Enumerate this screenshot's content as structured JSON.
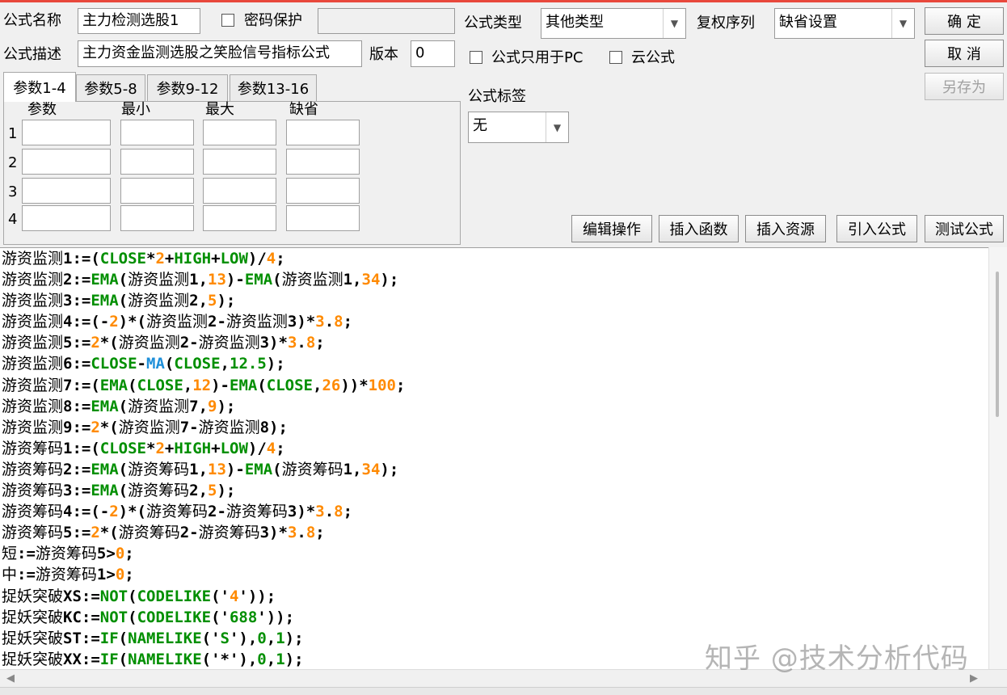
{
  "form": {
    "name_label": "公式名称",
    "name_value": "主力检测选股1",
    "password_label": "密码保护",
    "desc_label": "公式描述",
    "desc_value": "主力资金监测选股之笑脸信号指标公式",
    "version_label": "版本",
    "version_value": "0",
    "type_label": "公式类型",
    "type_value": "其他类型",
    "rights_label": "复权序列",
    "rights_value": "缺省设置",
    "pc_only_label": "公式只用于PC",
    "cloud_label": "云公式",
    "tag_label": "公式标签",
    "tag_value": "无"
  },
  "buttons": {
    "ok": "确  定",
    "cancel": "取  消",
    "save_as": "另存为",
    "edit_ops": "编辑操作",
    "insert_func": "插入函数",
    "insert_res": "插入资源",
    "import_formula": "引入公式",
    "test_formula": "测试公式"
  },
  "param_tabs": [
    "参数1-4",
    "参数5-8",
    "参数9-12",
    "参数13-16"
  ],
  "param_headers": [
    "参数",
    "最小",
    "最大",
    "缺省"
  ],
  "param_rows": [
    "1",
    "2",
    "3",
    "4"
  ],
  "code_lines": [
    [
      [
        "游资监测",
        "cn"
      ],
      [
        "1:=(",
        ""
      ],
      [
        "CLOSE",
        "kw"
      ],
      [
        "*",
        ""
      ],
      [
        "2",
        "num"
      ],
      [
        "+",
        ""
      ],
      [
        "HIGH",
        "kw"
      ],
      [
        "+",
        ""
      ],
      [
        "LOW",
        "kw"
      ],
      [
        ")/",
        ""
      ],
      [
        "4",
        "num"
      ],
      [
        ";",
        ""
      ]
    ],
    [
      [
        "游资监测",
        "cn"
      ],
      [
        "2:=",
        ""
      ],
      [
        "EMA",
        "kw"
      ],
      [
        "(",
        ""
      ],
      [
        "游资监测",
        "cn"
      ],
      [
        "1,",
        ""
      ],
      [
        "13",
        "num"
      ],
      [
        ")-",
        ""
      ],
      [
        "EMA",
        "kw"
      ],
      [
        "(",
        ""
      ],
      [
        "游资监测",
        "cn"
      ],
      [
        "1,",
        ""
      ],
      [
        "34",
        "num"
      ],
      [
        ");",
        ""
      ]
    ],
    [
      [
        "游资监测",
        "cn"
      ],
      [
        "3:=",
        ""
      ],
      [
        "EMA",
        "kw"
      ],
      [
        "(",
        ""
      ],
      [
        "游资监测",
        "cn"
      ],
      [
        "2,",
        ""
      ],
      [
        "5",
        "num"
      ],
      [
        ");",
        ""
      ]
    ],
    [
      [
        "游资监测",
        "cn"
      ],
      [
        "4:=(-",
        ""
      ],
      [
        "2",
        "num"
      ],
      [
        ")*(",
        ""
      ],
      [
        "游资监测",
        "cn"
      ],
      [
        "2-",
        ""
      ],
      [
        "游资监测",
        "cn"
      ],
      [
        "3)*",
        ""
      ],
      [
        "3",
        "num"
      ],
      [
        ".",
        ""
      ],
      [
        "8",
        "num"
      ],
      [
        ";",
        ""
      ]
    ],
    [
      [
        "游资监测",
        "cn"
      ],
      [
        "5:=",
        ""
      ],
      [
        "2",
        "num"
      ],
      [
        "*(",
        ""
      ],
      [
        "游资监测",
        "cn"
      ],
      [
        "2-",
        ""
      ],
      [
        "游资监测",
        "cn"
      ],
      [
        "3)*",
        ""
      ],
      [
        "3",
        "num"
      ],
      [
        ".",
        ""
      ],
      [
        "8",
        "num"
      ],
      [
        ";",
        ""
      ]
    ],
    [
      [
        "游资监测",
        "cn"
      ],
      [
        "6:=",
        ""
      ],
      [
        "CLOSE",
        "kw"
      ],
      [
        "-",
        ""
      ],
      [
        "MA",
        "blue"
      ],
      [
        "(",
        ""
      ],
      [
        "CLOSE",
        "kw"
      ],
      [
        ",",
        ""
      ],
      [
        "12.5",
        "kw"
      ],
      [
        ");",
        ""
      ]
    ],
    [
      [
        "游资监测",
        "cn"
      ],
      [
        "7:=(",
        ""
      ],
      [
        "EMA",
        "kw"
      ],
      [
        "(",
        ""
      ],
      [
        "CLOSE",
        "kw"
      ],
      [
        ",",
        ""
      ],
      [
        "12",
        "num"
      ],
      [
        ")-",
        ""
      ],
      [
        "EMA",
        "kw"
      ],
      [
        "(",
        ""
      ],
      [
        "CLOSE",
        "kw"
      ],
      [
        ",",
        ""
      ],
      [
        "26",
        "num"
      ],
      [
        "))*",
        ""
      ],
      [
        "100",
        "num"
      ],
      [
        ";",
        ""
      ]
    ],
    [
      [
        "游资监测",
        "cn"
      ],
      [
        "8:=",
        ""
      ],
      [
        "EMA",
        "kw"
      ],
      [
        "(",
        ""
      ],
      [
        "游资监测",
        "cn"
      ],
      [
        "7,",
        ""
      ],
      [
        "9",
        "num"
      ],
      [
        ");",
        ""
      ]
    ],
    [
      [
        "游资监测",
        "cn"
      ],
      [
        "9:=",
        ""
      ],
      [
        "2",
        "num"
      ],
      [
        "*(",
        ""
      ],
      [
        "游资监测",
        "cn"
      ],
      [
        "7-",
        ""
      ],
      [
        "游资监测",
        "cn"
      ],
      [
        "8);",
        ""
      ]
    ],
    [
      [
        "游资筹码",
        "cn"
      ],
      [
        "1:=(",
        ""
      ],
      [
        "CLOSE",
        "kw"
      ],
      [
        "*",
        ""
      ],
      [
        "2",
        "num"
      ],
      [
        "+",
        ""
      ],
      [
        "HIGH",
        "kw"
      ],
      [
        "+",
        ""
      ],
      [
        "LOW",
        "kw"
      ],
      [
        ")/",
        ""
      ],
      [
        "4",
        "num"
      ],
      [
        ";",
        ""
      ]
    ],
    [
      [
        "游资筹码",
        "cn"
      ],
      [
        "2:=",
        ""
      ],
      [
        "EMA",
        "kw"
      ],
      [
        "(",
        ""
      ],
      [
        "游资筹码",
        "cn"
      ],
      [
        "1,",
        ""
      ],
      [
        "13",
        "num"
      ],
      [
        ")-",
        ""
      ],
      [
        "EMA",
        "kw"
      ],
      [
        "(",
        ""
      ],
      [
        "游资筹码",
        "cn"
      ],
      [
        "1,",
        ""
      ],
      [
        "34",
        "num"
      ],
      [
        ");",
        ""
      ]
    ],
    [
      [
        "游资筹码",
        "cn"
      ],
      [
        "3:=",
        ""
      ],
      [
        "EMA",
        "kw"
      ],
      [
        "(",
        ""
      ],
      [
        "游资筹码",
        "cn"
      ],
      [
        "2,",
        ""
      ],
      [
        "5",
        "num"
      ],
      [
        ");",
        ""
      ]
    ],
    [
      [
        "游资筹码",
        "cn"
      ],
      [
        "4:=(-",
        ""
      ],
      [
        "2",
        "num"
      ],
      [
        ")*(",
        ""
      ],
      [
        "游资筹码",
        "cn"
      ],
      [
        "2-",
        ""
      ],
      [
        "游资筹码",
        "cn"
      ],
      [
        "3)*",
        ""
      ],
      [
        "3",
        "num"
      ],
      [
        ".",
        ""
      ],
      [
        "8",
        "num"
      ],
      [
        ";",
        ""
      ]
    ],
    [
      [
        "游资筹码",
        "cn"
      ],
      [
        "5:=",
        ""
      ],
      [
        "2",
        "num"
      ],
      [
        "*(",
        ""
      ],
      [
        "游资筹码",
        "cn"
      ],
      [
        "2-",
        ""
      ],
      [
        "游资筹码",
        "cn"
      ],
      [
        "3)*",
        ""
      ],
      [
        "3",
        "num"
      ],
      [
        ".",
        ""
      ],
      [
        "8",
        "num"
      ],
      [
        ";",
        ""
      ]
    ],
    [
      [
        "短",
        "cn"
      ],
      [
        ":=",
        ""
      ],
      [
        "游资筹码",
        "cn"
      ],
      [
        "5>",
        ""
      ],
      [
        "0",
        "num"
      ],
      [
        ";",
        ""
      ]
    ],
    [
      [
        "中",
        "cn"
      ],
      [
        ":=",
        ""
      ],
      [
        "游资筹码",
        "cn"
      ],
      [
        "1>",
        ""
      ],
      [
        "0",
        "num"
      ],
      [
        ";",
        ""
      ]
    ],
    [
      [
        "捉妖突破",
        "cn"
      ],
      [
        "XS:=",
        ""
      ],
      [
        "NOT",
        "kw"
      ],
      [
        "(",
        ""
      ],
      [
        "CODELIKE",
        "kw"
      ],
      [
        "('",
        ""
      ],
      [
        "4",
        "num"
      ],
      [
        "'));",
        ""
      ]
    ],
    [
      [
        "捉妖突破",
        "cn"
      ],
      [
        "KC:=",
        ""
      ],
      [
        "NOT",
        "kw"
      ],
      [
        "(",
        ""
      ],
      [
        "CODELIKE",
        "kw"
      ],
      [
        "('",
        ""
      ],
      [
        "688",
        "kw"
      ],
      [
        "'));",
        ""
      ]
    ],
    [
      [
        "捉妖突破",
        "cn"
      ],
      [
        "ST:=",
        ""
      ],
      [
        "IF",
        "kw"
      ],
      [
        "(",
        ""
      ],
      [
        "NAMELIKE",
        "kw"
      ],
      [
        "('",
        ""
      ],
      [
        "S",
        "kw"
      ],
      [
        "'),",
        ""
      ],
      [
        "0",
        "kw"
      ],
      [
        ",",
        ""
      ],
      [
        "1",
        "kw"
      ],
      [
        ");",
        ""
      ]
    ],
    [
      [
        "捉妖突破",
        "cn"
      ],
      [
        "XX:=",
        ""
      ],
      [
        "IF",
        "kw"
      ],
      [
        "(",
        ""
      ],
      [
        "NAMELIKE",
        "kw"
      ],
      [
        "('*'),",
        ""
      ],
      [
        "0",
        "kw"
      ],
      [
        ",",
        ""
      ],
      [
        "1",
        "kw"
      ],
      [
        ");",
        ""
      ]
    ]
  ],
  "watermark": "知乎 @技术分析代码",
  "colors": {
    "keyword": "#008f00",
    "number": "#ff8a00",
    "func_blue": "#1e8fd9",
    "top_border": "#e8483c"
  }
}
